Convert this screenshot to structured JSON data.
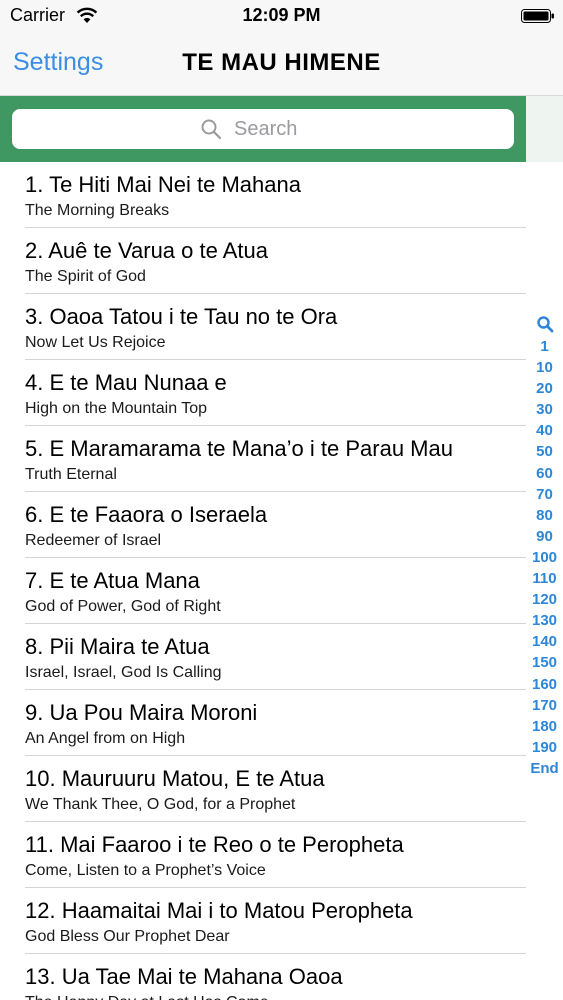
{
  "status_bar": {
    "carrier": "Carrier",
    "time": "12:09 PM",
    "icons": [
      "wifi-icon",
      "battery-icon"
    ]
  },
  "nav_bar": {
    "back_label": "Settings",
    "title": "TE MAU HIMENE"
  },
  "search": {
    "placeholder": "Search",
    "icon": "search-icon"
  },
  "colors": {
    "accent": "#3a8ee6",
    "search_bar_bg": "#3f9761",
    "index_color": "#2e86d6"
  },
  "hymns": [
    {
      "title": "1. Te Hiti Mai Nei te Mahana",
      "subtitle": "The Morning Breaks"
    },
    {
      "title": "2. Auê te Varua o te Atua",
      "subtitle": "The Spirit of God"
    },
    {
      "title": "3. Oaoa Tatou i te Tau no te Ora",
      "subtitle": "Now Let Us Rejoice"
    },
    {
      "title": "4. E te Mau Nunaa e",
      "subtitle": "High on the Mountain Top"
    },
    {
      "title": "5. E Maramarama te Mana’o i te Parau Mau",
      "subtitle": "Truth Eternal"
    },
    {
      "title": "6. E te Faaora o Iseraela",
      "subtitle": "Redeemer of Israel"
    },
    {
      "title": "7. E te Atua Mana",
      "subtitle": "God of Power, God of Right"
    },
    {
      "title": "8. Pii Maira te Atua",
      "subtitle": "Israel, Israel, God Is Calling"
    },
    {
      "title": "9. Ua Pou Maira Moroni",
      "subtitle": "An Angel from on High"
    },
    {
      "title": "10. Mauruuru Matou, E te Atua",
      "subtitle": "We Thank Thee, O God, for a Prophet"
    },
    {
      "title": "11. Mai Faaroo i te Reo o te Peropheta",
      "subtitle": "Come, Listen to a Prophet’s Voice"
    },
    {
      "title": "12. Haamaitai Mai i to Matou Peropheta",
      "subtitle": "God Bless Our Prophet Dear"
    },
    {
      "title": "13. Ua Tae Mai te Mahana Oaoa",
      "subtitle": "The Happy Day at Last Has Come"
    }
  ],
  "section_index": [
    "1",
    "10",
    "20",
    "30",
    "40",
    "50",
    "60",
    "70",
    "80",
    "90",
    "100",
    "110",
    "120",
    "130",
    "140",
    "150",
    "160",
    "170",
    "180",
    "190",
    "End"
  ]
}
